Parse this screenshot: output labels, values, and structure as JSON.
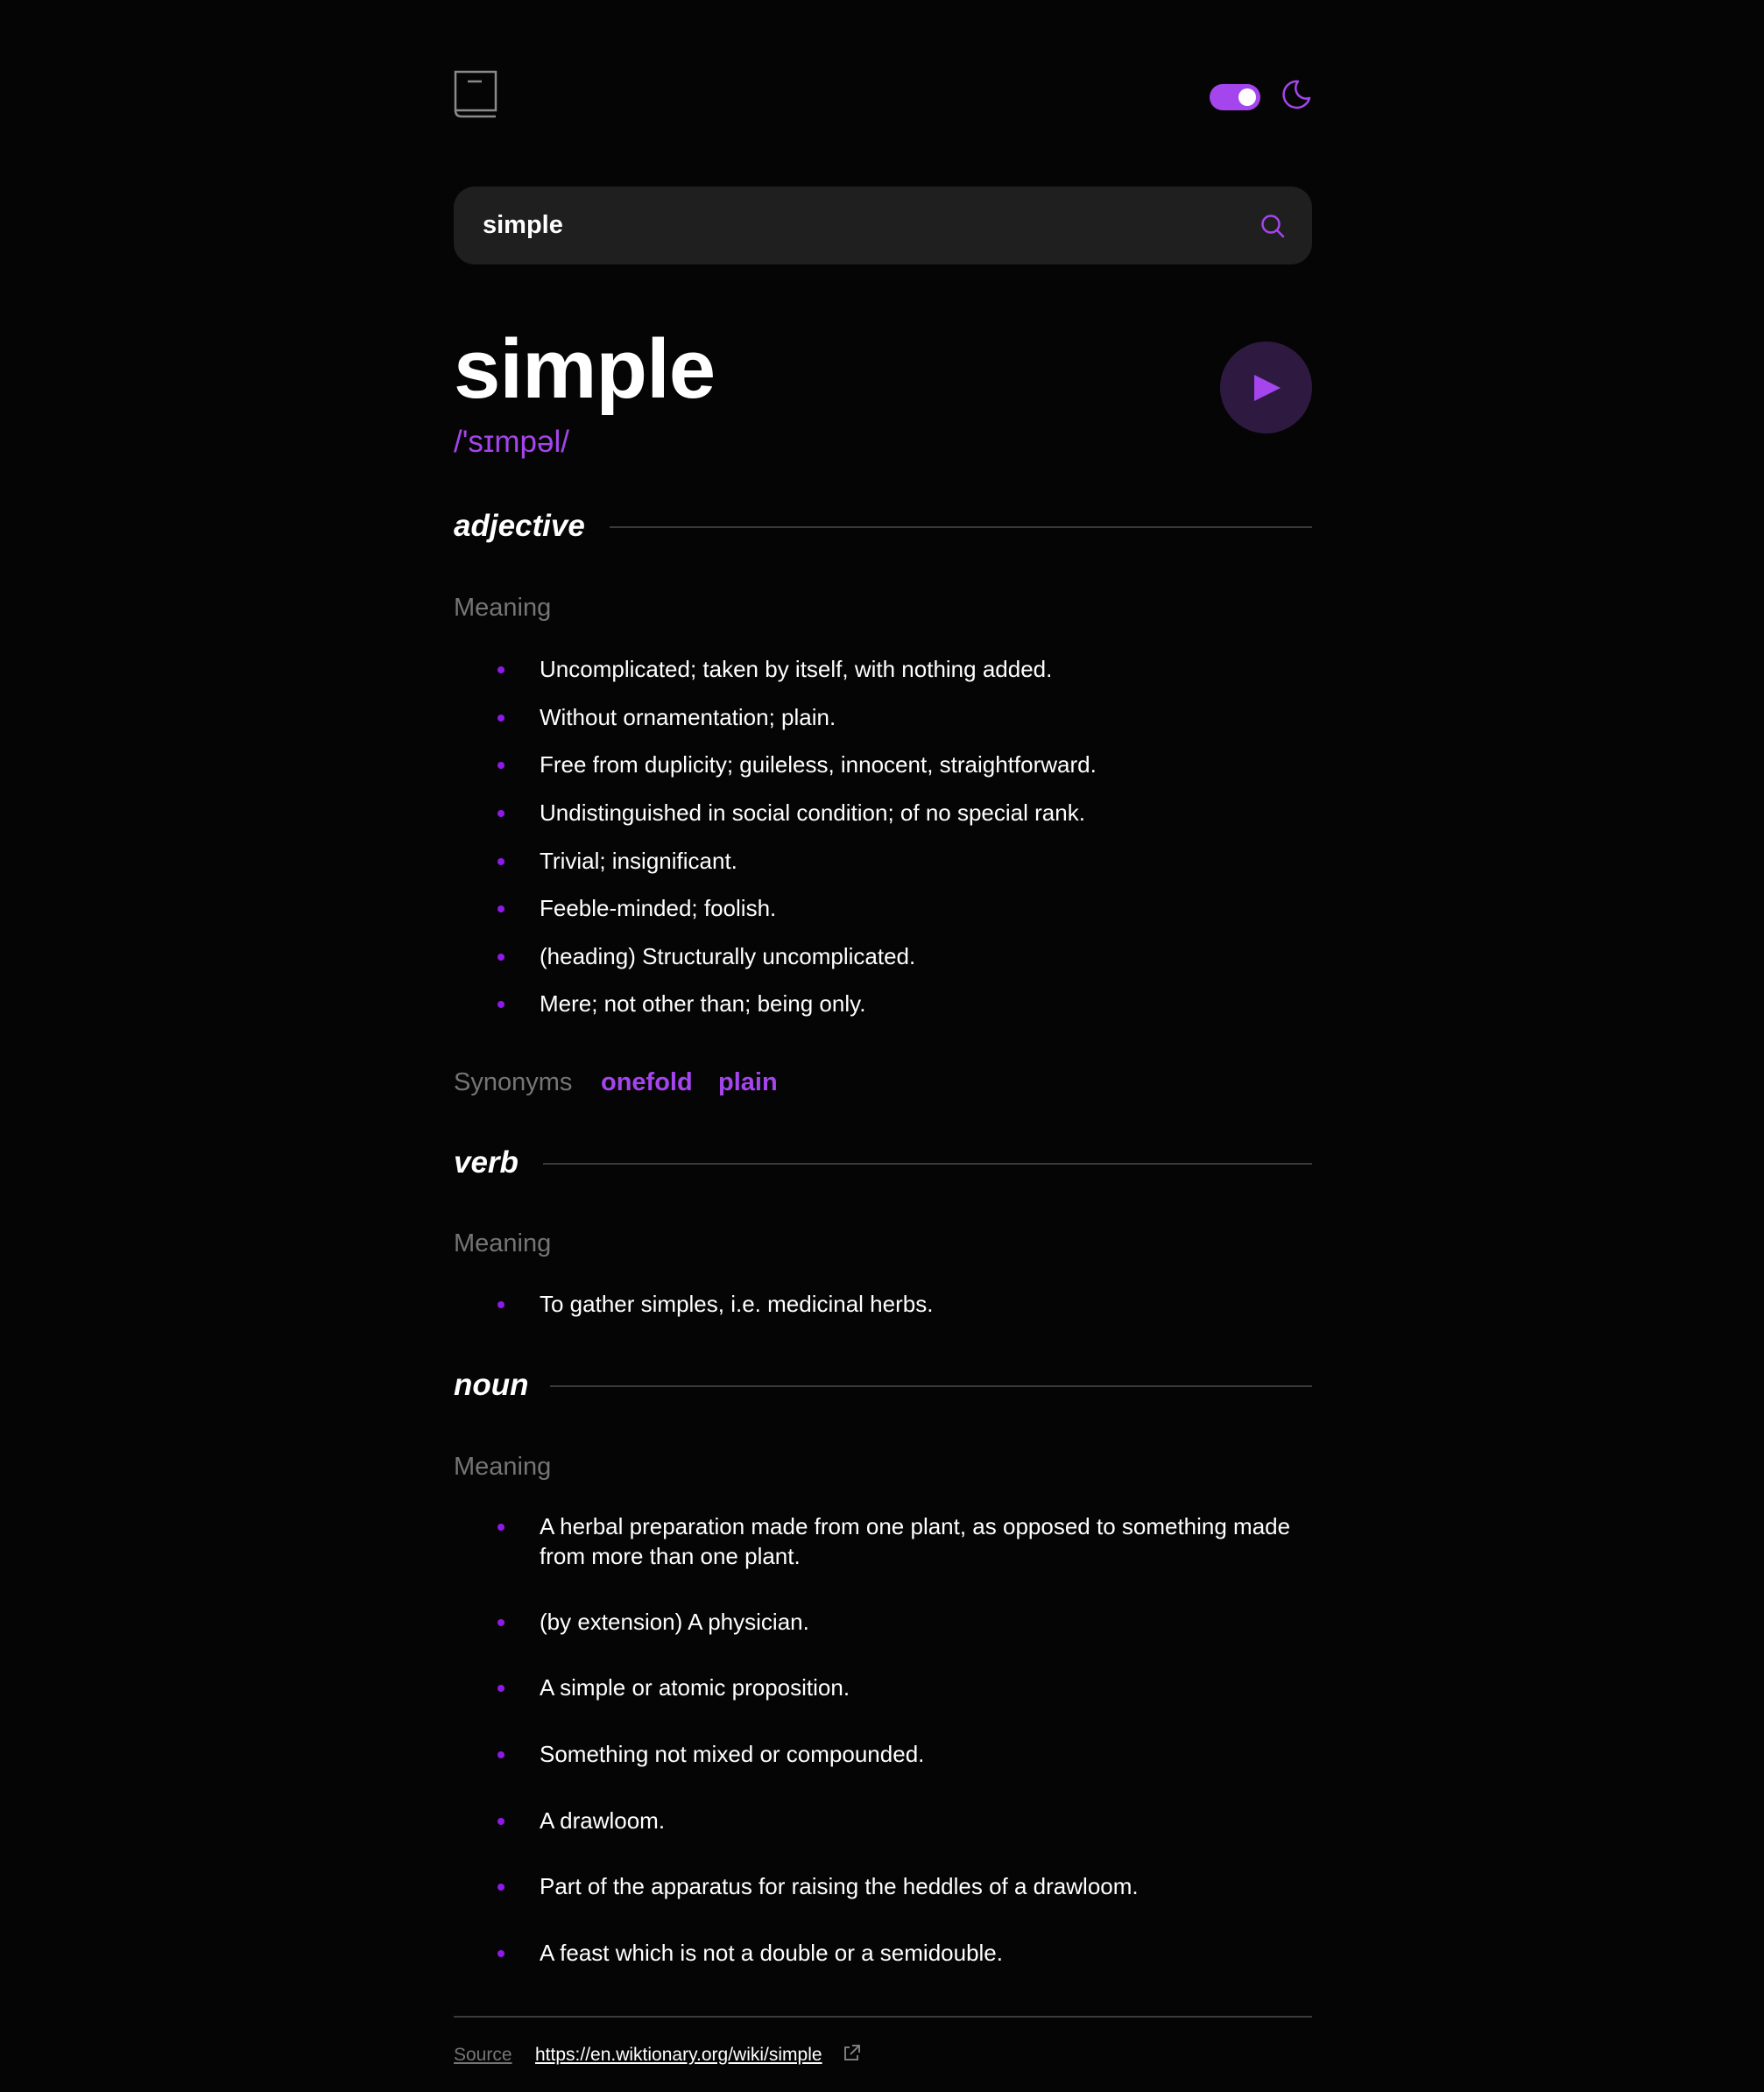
{
  "header": {
    "logo_icon": "book-icon",
    "theme_toggle": {
      "state": "on",
      "color": "#a445ed"
    },
    "theme_icon": "moon-icon"
  },
  "search": {
    "value": "simple",
    "icon": "search-icon"
  },
  "entry": {
    "word": "simple",
    "phonetic": "/'sɪmpəl/",
    "play_icon": "play-icon"
  },
  "meanings": [
    {
      "part_of_speech": "adjective",
      "meaning_label": "Meaning",
      "definitions": [
        "Uncomplicated; taken by itself, with nothing added.",
        "Without ornamentation; plain.",
        "Free from duplicity; guileless, innocent, straightforward.",
        "Undistinguished in social condition; of no special rank.",
        "Trivial; insignificant.",
        "Feeble-minded; foolish.",
        "(heading) Structurally uncomplicated.",
        "Mere; not other than; being only."
      ],
      "synonyms_label": "Synonyms",
      "synonyms": [
        "onefold",
        "plain"
      ]
    },
    {
      "part_of_speech": "verb",
      "meaning_label": "Meaning",
      "definitions": [
        "To gather simples, i.e. medicinal herbs."
      ]
    },
    {
      "part_of_speech": "noun",
      "meaning_label": "Meaning",
      "definitions": [
        "A herbal preparation made from one plant, as opposed to something made from more than one plant.",
        "(by extension) A physician.",
        "A simple or atomic proposition.",
        "Something not mixed or compounded.",
        "A drawloom.",
        "Part of the apparatus for raising the heddles of a drawloom.",
        "A feast which is not a double or a semidouble."
      ]
    }
  ],
  "footer": {
    "source_label": "Source",
    "source_url": "https://en.wiktionary.org/wiki/simple",
    "external_icon": "external-link-icon"
  },
  "colors": {
    "accent": "#a445ed",
    "background": "#050505",
    "muted": "#757575"
  }
}
